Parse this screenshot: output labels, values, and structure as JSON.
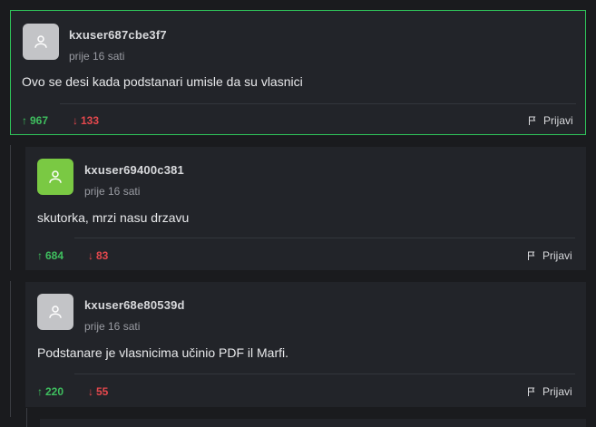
{
  "colors": {
    "background": "#1a1b1e",
    "card": "#222429",
    "highlight_border": "#2fc55a",
    "upvote": "#3fbf5f",
    "downvote": "#e5484d",
    "avatar_gray": "#c3c4c7",
    "avatar_green": "#7ac943"
  },
  "comments": [
    {
      "username": "kxuser687cbe3f7",
      "time": "prije 16 sati",
      "text": "Ovo se desi kada podstanari umisle da su vlasnici",
      "upvotes": "967",
      "downvotes": "133",
      "report_label": "Prijavi",
      "avatar_icon": "user-icon"
    },
    {
      "username": "kxuser69400c381",
      "time": "prije 16 sati",
      "text": "skutorka, mrzi nasu drzavu",
      "upvotes": "684",
      "downvotes": "83",
      "report_label": "Prijavi",
      "avatar_icon": "user-icon"
    },
    {
      "username": "kxuser68e80539d",
      "time": "prije 16 sati",
      "text": "Podstanare je vlasnicima učinio PDF il Marfi.",
      "upvotes": "220",
      "downvotes": "55",
      "report_label": "Prijavi",
      "avatar_icon": "user-icon"
    }
  ],
  "icons": {
    "upvote": "↑",
    "downvote": "↓"
  }
}
